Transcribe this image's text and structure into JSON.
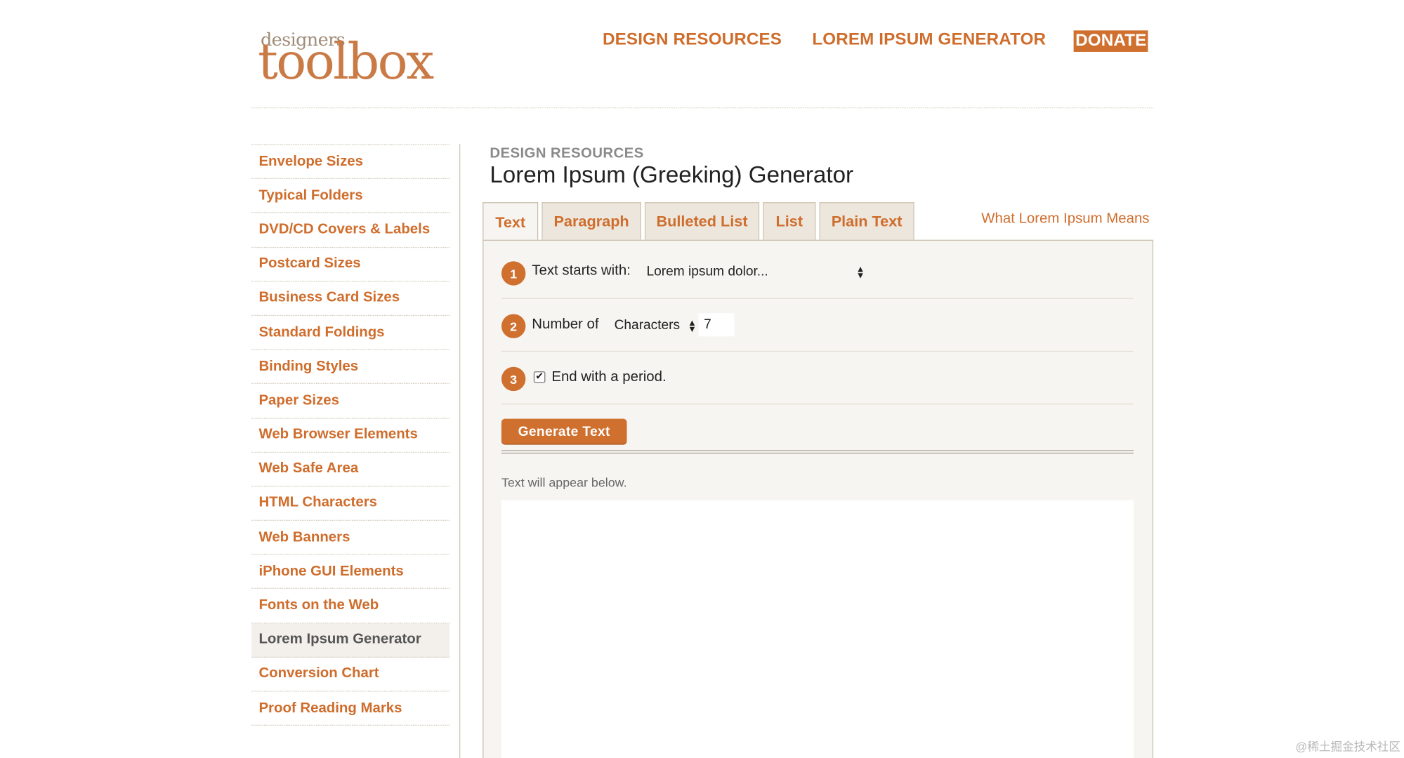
{
  "logo": {
    "small_text": "designers",
    "big_text": "toolbox"
  },
  "top_nav": [
    "DESIGN RESOURCES",
    "LOREM IPSUM GENERATOR",
    "DONATE"
  ],
  "sidebar": {
    "items": [
      "Envelope Sizes",
      "Typical Folders",
      "DVD/CD Covers & Labels",
      "Postcard Sizes",
      "Business Card Sizes",
      "Standard Foldings",
      "Binding Styles",
      "Paper Sizes",
      "Web Browser Elements",
      "Web Safe Area",
      "HTML Characters",
      "Web Banners",
      "iPhone GUI Elements",
      "Fonts on the Web",
      "Lorem Ipsum Generator",
      "Conversion Chart",
      "Proof Reading Marks"
    ],
    "active": "Lorem Ipsum Generator"
  },
  "content": {
    "section_label": "DESIGN RESOURCES",
    "title": "Lorem Ipsum (Greeking) Generator",
    "tabs": [
      "Text",
      "Paragraph",
      "Bulleted List",
      "List",
      "Plain Text"
    ],
    "active_tab": "Text",
    "what_link": "What Lorem Ipsum Means",
    "steps": {
      "one": {
        "num": "1",
        "label": "Text starts with:",
        "value": "Lorem ipsum dolor..."
      },
      "two": {
        "num": "2",
        "label": "Number of",
        "unit": "Characters",
        "count": "7"
      },
      "three": {
        "num": "3",
        "label": "End with a period.",
        "checked": true
      }
    },
    "generate_button": "Generate Text",
    "hint": "Text will appear below.",
    "output": ""
  },
  "watermark": "@稀土掘金技术社区",
  "colors": {
    "accent": "#d0702f",
    "link": "#cf6d2c",
    "panel_bg": "#f7f5f1",
    "border": "#c9bfae"
  }
}
